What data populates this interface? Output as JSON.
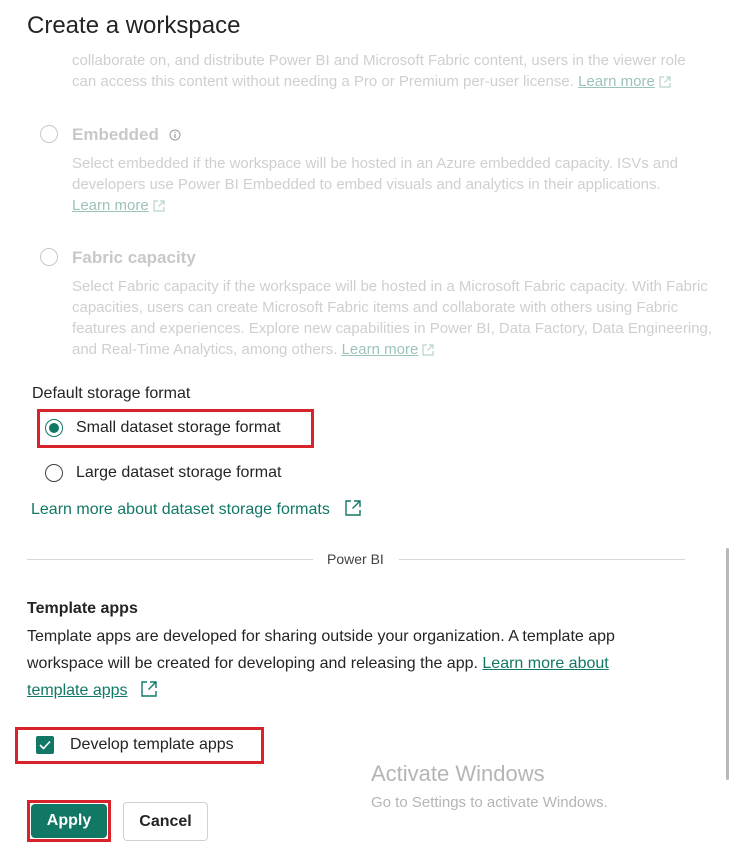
{
  "dialog": {
    "title": "Create a workspace"
  },
  "license_options": {
    "viewer_tail_line1": "collaborate on, and distribute Power BI and Microsoft Fabric content, users in the viewer role",
    "viewer_tail_line2": "can access this content without needing a Pro or Premium per-user license.",
    "viewer_learn_more": "Learn more",
    "embedded": {
      "label": "Embedded",
      "info_icon": "info-icon",
      "line1": "Select embedded if the workspace will be hosted in an Azure embedded capacity. ISVs and",
      "line2": "developers use Power BI Embedded to embed visuals and analytics in their applications.",
      "learn_more": "Learn more"
    },
    "fabric": {
      "label": "Fabric capacity",
      "line1": "Select Fabric capacity if the workspace will be hosted in a Microsoft Fabric capacity. With Fabric",
      "line2": "capacities, users can create Microsoft Fabric items and collaborate with others using Fabric",
      "line3": "features and experiences. Explore new capabilities in Power BI, Data Factory, Data Engineering,",
      "line4": "and Real-Time Analytics, among others.",
      "learn_more": "Learn more"
    }
  },
  "storage": {
    "heading": "Default storage format",
    "small_label": "Small dataset storage format",
    "small_selected": true,
    "large_label": "Large dataset storage format",
    "learn_more": "Learn more about dataset storage formats"
  },
  "divider": {
    "label": "Power BI"
  },
  "template_apps": {
    "heading": "Template apps",
    "line1": "Template apps are developed for sharing outside your organization. A template app",
    "line2_prefix": "workspace will be created for developing and releasing the app.",
    "line2_link": "Learn more about",
    "line3_link": "template apps",
    "checkbox_label": "Develop template apps",
    "checkbox_checked": true
  },
  "actions": {
    "apply": "Apply",
    "cancel": "Cancel"
  },
  "watermark": {
    "title": "Activate Windows",
    "subtitle": "Go to Settings to activate Windows."
  },
  "colors": {
    "accent": "#117865",
    "highlight": "#d8232a"
  }
}
